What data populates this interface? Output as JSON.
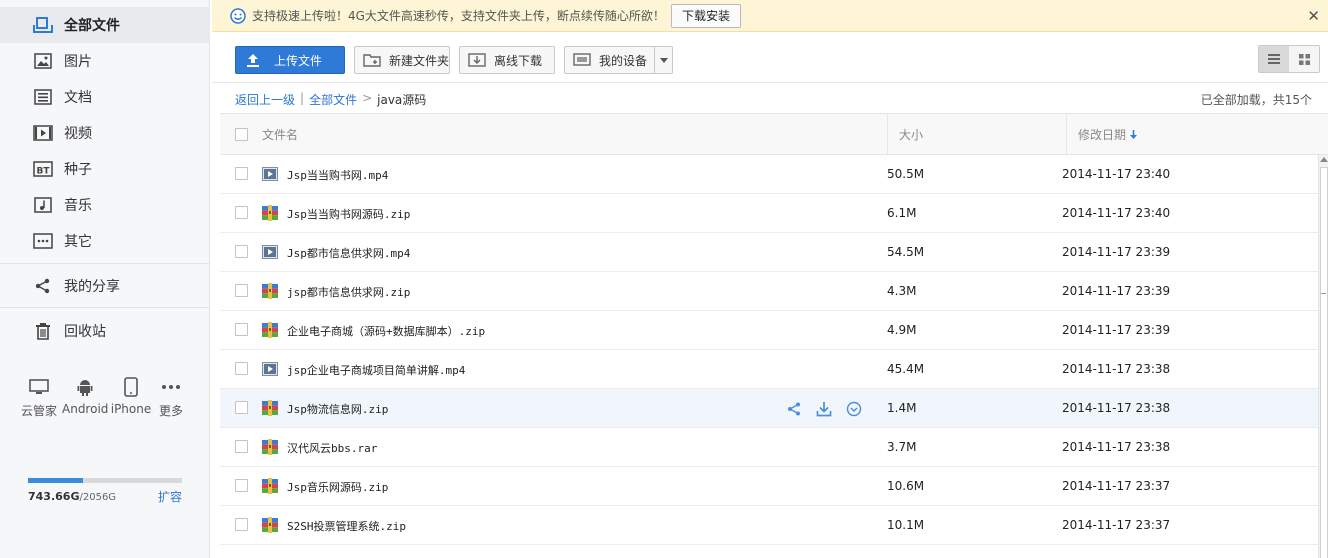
{
  "sidebar": {
    "items": [
      {
        "label": "全部文件",
        "icon": "all-files-icon"
      },
      {
        "label": "图片",
        "icon": "image-icon"
      },
      {
        "label": "文档",
        "icon": "document-icon"
      },
      {
        "label": "视频",
        "icon": "video-icon"
      },
      {
        "label": "种子",
        "icon": "bt-icon"
      },
      {
        "label": "音乐",
        "icon": "music-icon"
      },
      {
        "label": "其它",
        "icon": "other-icon"
      },
      {
        "label": "我的分享",
        "icon": "share-icon"
      },
      {
        "label": "回收站",
        "icon": "trash-icon"
      }
    ],
    "devices": [
      {
        "label": "云管家",
        "icon": "desktop-icon"
      },
      {
        "label": "Android",
        "icon": "android-icon"
      },
      {
        "label": "iPhone",
        "icon": "iphone-icon"
      },
      {
        "label": "更多",
        "icon": "more-icon"
      }
    ],
    "quota": {
      "used": "743.66G",
      "total": "/2056G",
      "used_fraction": 0.36,
      "expand_label": "扩容"
    }
  },
  "notice": {
    "message": "支持极速上传啦！4G大文件高速秒传，支持文件夹上传，断点续传随心所欲！",
    "button": "下载安装",
    "close": "✕"
  },
  "toolbar": {
    "upload": "上传文件",
    "new_folder": "新建文件夹",
    "offline": "离线下载",
    "devices": "我的设备"
  },
  "breadcrumb": {
    "back": "返回上一级",
    "sep": "|",
    "root": "全部文件",
    "arrow": ">",
    "current": "java源码"
  },
  "loaded_text": "已全部加载，共15个",
  "table": {
    "headers": {
      "name": "文件名",
      "size": "大小",
      "date": "修改日期"
    },
    "rows": [
      {
        "name": "Jsp当当购书网.mp4",
        "type": "video",
        "size": "50.5M",
        "date": "2014-11-17 23:40"
      },
      {
        "name": "Jsp当当购书网源码.zip",
        "type": "zip",
        "size": "6.1M",
        "date": "2014-11-17 23:40"
      },
      {
        "name": "Jsp都市信息供求网.mp4",
        "type": "video",
        "size": "54.5M",
        "date": "2014-11-17 23:39"
      },
      {
        "name": "jsp都市信息供求网.zip",
        "type": "zip",
        "size": "4.3M",
        "date": "2014-11-17 23:39"
      },
      {
        "name": "企业电子商城（源码+数据库脚本）.zip",
        "type": "zip",
        "size": "4.9M",
        "date": "2014-11-17 23:39"
      },
      {
        "name": "jsp企业电子商城项目简单讲解.mp4",
        "type": "video",
        "size": "45.4M",
        "date": "2014-11-17 23:38"
      },
      {
        "name": "Jsp物流信息网.zip",
        "type": "zip",
        "size": "1.4M",
        "date": "2014-11-17 23:38",
        "hover": true
      },
      {
        "name": "汉代风云bbs.rar",
        "type": "zip",
        "size": "3.7M",
        "date": "2014-11-17 23:38"
      },
      {
        "name": "Jsp音乐网源码.zip",
        "type": "zip",
        "size": "10.6M",
        "date": "2014-11-17 23:37"
      },
      {
        "name": "S2SH投票管理系统.zip",
        "type": "zip",
        "size": "10.1M",
        "date": "2014-11-17 23:37"
      }
    ]
  },
  "colors": {
    "accent": "#2f7ad6",
    "link": "#2c75d8",
    "notice_bg": "#fdf5d6",
    "hover_row": "#f1f6fd"
  }
}
